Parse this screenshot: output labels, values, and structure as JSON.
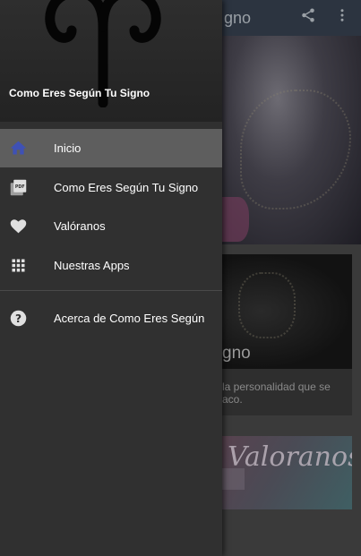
{
  "app": {
    "title": "gno",
    "card_title": "gno",
    "card_description": "la personalidad que se\naco.",
    "banner_text": "Valoranos"
  },
  "drawer": {
    "header_title": "Como Eres Según Tu Signo",
    "items": [
      {
        "label": "Inicio",
        "icon": "home-icon",
        "active": true
      },
      {
        "label": "Como Eres Según Tu Signo",
        "icon": "pdf-icon",
        "active": false
      },
      {
        "label": "Valóranos",
        "icon": "heart-icon",
        "active": false
      },
      {
        "label": "Nuestras Apps",
        "icon": "apps-grid-icon",
        "active": false
      }
    ],
    "footer_items": [
      {
        "label": "Acerca de Como Eres Según",
        "icon": "help-icon"
      }
    ]
  },
  "colors": {
    "accent": "#3f51b5",
    "drawer_bg": "#303030",
    "active_item_bg": "#5e5e5e"
  }
}
